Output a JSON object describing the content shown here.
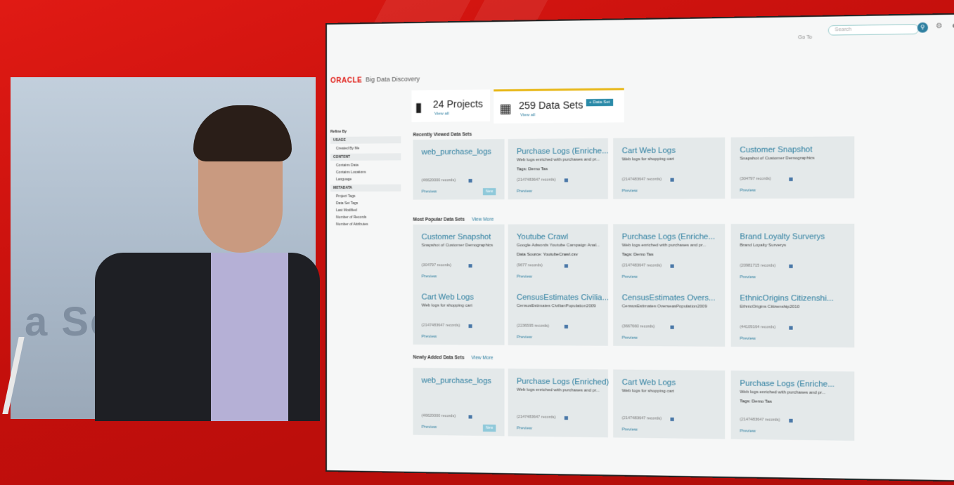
{
  "app": {
    "brand": "ORACLE",
    "product": "Big Data Discovery"
  },
  "header": {
    "goto_label": "Go To",
    "search_placeholder": "Search"
  },
  "tabs": [
    {
      "title": "24 Projects",
      "view_all": "View all"
    },
    {
      "title": "259 Data Sets",
      "view_all": "View all",
      "button": "+ Data Set"
    }
  ],
  "refine": {
    "heading": "Refine By",
    "sections": [
      {
        "label": "USAGE",
        "items": [
          "Created By Me"
        ]
      },
      {
        "label": "CONTENT",
        "items": [
          "Contains Data",
          "Contains Locations",
          "Language"
        ]
      },
      {
        "label": "METADATA",
        "items": [
          "Project Tags",
          "Data Set Tags",
          "Last Modified",
          "Number of Records",
          "Number of Attributes"
        ]
      }
    ]
  },
  "background_text": "a Sets",
  "sections": [
    {
      "title": "Recently Viewed Data Sets",
      "view_more": "",
      "cards": [
        {
          "title": "web_purchase_logs",
          "desc": "",
          "tag": "",
          "records": "(46620000 records)",
          "preview": "Preview",
          "new": "New"
        },
        {
          "title": "Purchase Logs (Enriche...",
          "desc": "Web logs enriched with purchases and pr...",
          "tag": "Tags: Demo Tas",
          "records": "(2147483647 records)",
          "preview": "Preview",
          "new": ""
        },
        {
          "title": "Cart Web Logs",
          "desc": "Web logs for shopping cart",
          "tag": "",
          "records": "(2147483647 records)",
          "preview": "Preview",
          "new": ""
        },
        {
          "title": "Customer Snapshot",
          "desc": "Snapshot of Customer Demographics",
          "tag": "",
          "records": "(304797 records)",
          "preview": "Preview",
          "new": ""
        }
      ]
    },
    {
      "title": "Most Popular Data Sets",
      "view_more": "View More",
      "cards": [
        {
          "title": "Customer Snapshot",
          "desc": "Snapshot of Customer Demographics",
          "tag": "",
          "records": "(304797 records)",
          "preview": "Preview",
          "new": ""
        },
        {
          "title": "Youtube Crawl",
          "desc": "Google Adwords Youtube Campaign Anal...",
          "tag": "Data Source: YoutubeCrawl.csv",
          "records": "(9677 records)",
          "preview": "Preview",
          "new": ""
        },
        {
          "title": "Purchase Logs (Enriche...",
          "desc": "Web logs enriched with purchases and pr...",
          "tag": "Tags: Demo Tas",
          "records": "(2147483647 records)",
          "preview": "Preview",
          "new": ""
        },
        {
          "title": "Brand Loyalty Surverys",
          "desc": "Brand Loyalty Surverys",
          "tag": "",
          "records": "(20981715 records)",
          "preview": "Preview",
          "new": ""
        },
        {
          "title": "Cart Web Logs",
          "desc": "Web logs for shopping cart",
          "tag": "",
          "records": "(2147483647 records)",
          "preview": "Preview",
          "new": ""
        },
        {
          "title": "CensusEstimates Civilia...",
          "desc": "CensusEstimates CivilianPopulation2009",
          "tag": "",
          "records": "(2236595 records)",
          "preview": "Preview",
          "new": ""
        },
        {
          "title": "CensusEstimates Overs...",
          "desc": "CensusEstimates OverseasPopulation2009",
          "tag": "",
          "records": "(3667660 records)",
          "preview": "Preview",
          "new": ""
        },
        {
          "title": "EthnicOrigins Citizenshi...",
          "desc": "EthnicOrigins Citizenship2010",
          "tag": "",
          "records": "(44109164 records)",
          "preview": "Preview",
          "new": ""
        }
      ]
    },
    {
      "title": "Newly Added Data Sets",
      "view_more": "View More",
      "cards": [
        {
          "title": "web_purchase_logs",
          "desc": "",
          "tag": "",
          "records": "(46620000 records)",
          "preview": "Preview",
          "new": "New"
        },
        {
          "title": "Purchase Logs (Enriched)",
          "desc": "Web logs enriched with purchases and pr...",
          "tag": "",
          "records": "(2147483647 records)",
          "preview": "Preview",
          "new": ""
        },
        {
          "title": "Cart Web Logs",
          "desc": "Web logs for shopping cart",
          "tag": "",
          "records": "(2147483647 records)",
          "preview": "Preview",
          "new": ""
        },
        {
          "title": "Purchase Logs (Enriche...",
          "desc": "Web logs enriched with purchases and pr...",
          "tag": "Tags: Demo Tas",
          "records": "(2147483647 records)",
          "preview": "Preview",
          "new": ""
        }
      ]
    }
  ]
}
